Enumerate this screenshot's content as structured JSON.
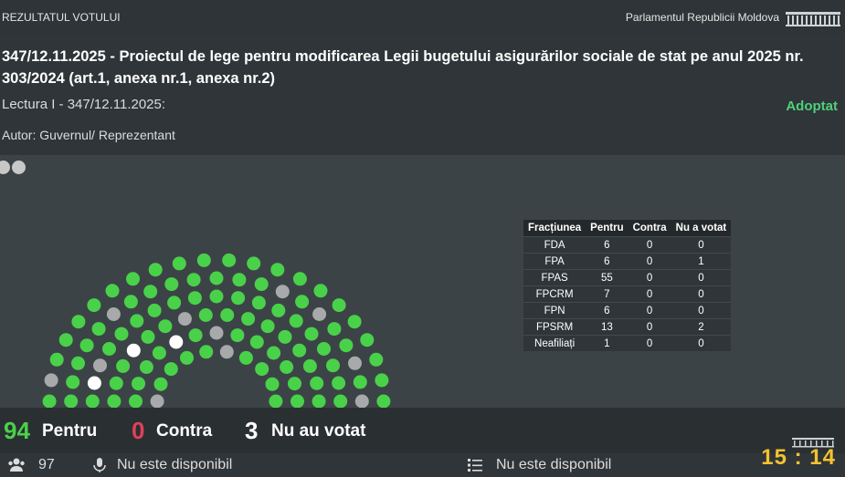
{
  "topbar": {
    "left_label": "REZULTATUL VOTULUI",
    "right_label": "Parlamentul Republicii Moldova"
  },
  "header": {
    "title": "347/12.11.2025 - Proiectul de lege pentru modificarea Legii bugetului asigurărilor sociale de stat pe anul 2025 nr. 303/2024 (art.1, anexa nr.1, anexa nr.2)",
    "reading": "Lectura I - 347/12.11.2025:",
    "status": "Adoptat",
    "author": "Autor: Guvernul/ Reprezentant"
  },
  "table": {
    "headers": [
      "Fracțiunea",
      "Pentru",
      "Contra",
      "Nu a votat"
    ],
    "rows": [
      [
        "FDA",
        "6",
        "0",
        "0"
      ],
      [
        "FPA",
        "6",
        "0",
        "1"
      ],
      [
        "FPAS",
        "55",
        "0",
        "0"
      ],
      [
        "FPCRM",
        "7",
        "0",
        "0"
      ],
      [
        "FPN",
        "6",
        "0",
        "0"
      ],
      [
        "FPSRM",
        "13",
        "0",
        "2"
      ],
      [
        "Neafiliați",
        "1",
        "0",
        "0"
      ]
    ]
  },
  "summary": {
    "pentru_count": "94",
    "pentru_label": "Pentru",
    "contra_count": "0",
    "contra_label": "Contra",
    "nu_count": "3",
    "nu_label": "Nu au votat"
  },
  "footer": {
    "present_count": "97",
    "mic_text": "Nu este disponibil",
    "list_text": "Nu este disponibil"
  },
  "clock": "15 : 14",
  "colors": {
    "green": "#4ad14a",
    "grey": "#a7a9aa",
    "white": "#ffffff",
    "red": "#e0405a",
    "adopted": "#4fd07a",
    "clock": "#f2c230"
  }
}
